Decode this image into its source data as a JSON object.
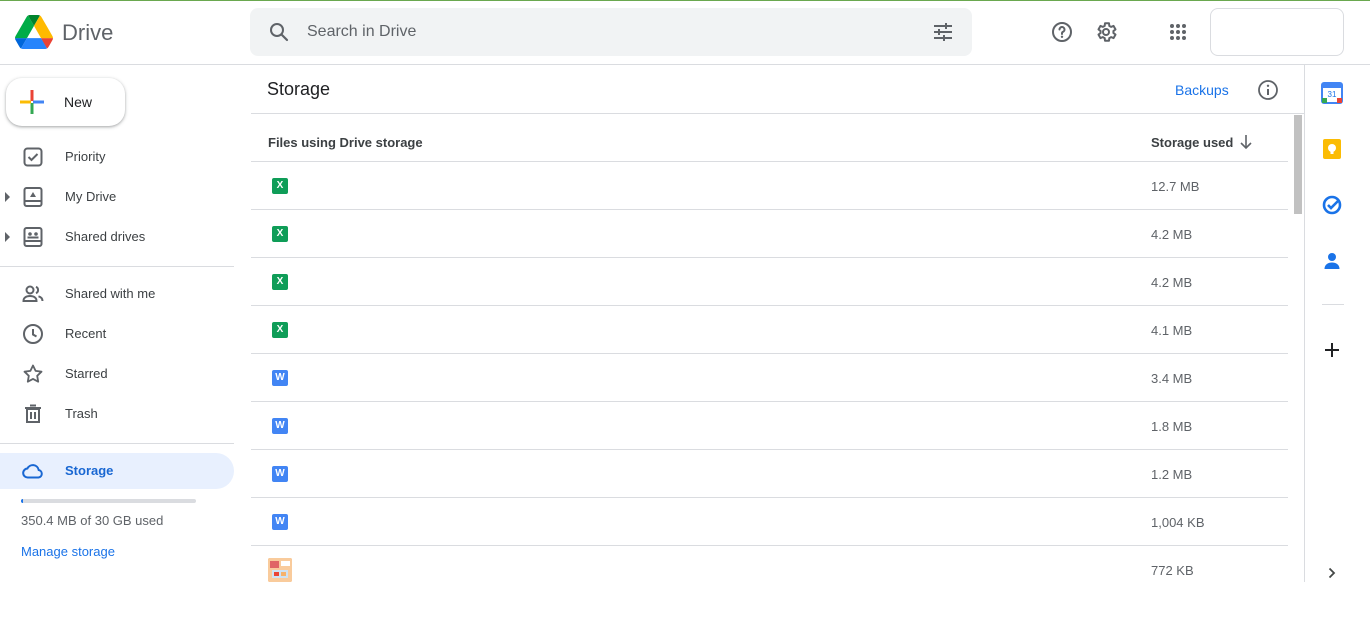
{
  "app": {
    "product_name": "Drive",
    "accent": "#1a73e8"
  },
  "search": {
    "placeholder": "Search in Drive",
    "value": ""
  },
  "header_icons": [
    "help-icon",
    "settings-icon",
    "apps-icon"
  ],
  "new_button": {
    "label": "New"
  },
  "sidebar": {
    "items": [
      {
        "id": "priority",
        "label": "Priority",
        "icon": "priority-icon",
        "expandable": false
      },
      {
        "id": "my-drive",
        "label": "My Drive",
        "icon": "my-drive-icon",
        "expandable": true
      },
      {
        "id": "shared-drives",
        "label": "Shared drives",
        "icon": "shared-drives-icon",
        "expandable": true
      },
      {
        "id": "shared-with-me",
        "label": "Shared with me",
        "icon": "people-icon",
        "expandable": false
      },
      {
        "id": "recent",
        "label": "Recent",
        "icon": "clock-icon",
        "expandable": false
      },
      {
        "id": "starred",
        "label": "Starred",
        "icon": "star-icon",
        "expandable": false
      },
      {
        "id": "trash",
        "label": "Trash",
        "icon": "trash-icon",
        "expandable": false
      },
      {
        "id": "storage",
        "label": "Storage",
        "icon": "cloud-icon",
        "expandable": false,
        "active": true
      }
    ],
    "quota": {
      "text": "350.4 MB of 30 GB used",
      "used_fraction": 0.0114
    },
    "manage_link": "Manage storage"
  },
  "main": {
    "title": "Storage",
    "backups_link": "Backups",
    "table": {
      "columns": {
        "name": "Files using Drive storage",
        "size": "Storage used"
      },
      "sort": "descending",
      "rows": [
        {
          "type": "xlsx",
          "icon_text": "X",
          "size": "12.7 MB"
        },
        {
          "type": "xlsx",
          "icon_text": "X",
          "size": "4.2 MB"
        },
        {
          "type": "xlsx",
          "icon_text": "X",
          "size": "4.2 MB"
        },
        {
          "type": "xlsx",
          "icon_text": "X",
          "size": "4.1 MB"
        },
        {
          "type": "docx",
          "icon_text": "W",
          "size": "3.4 MB"
        },
        {
          "type": "docx",
          "icon_text": "W",
          "size": "1.8 MB"
        },
        {
          "type": "docx",
          "icon_text": "W",
          "size": "1.2 MB"
        },
        {
          "type": "docx",
          "icon_text": "W",
          "size": "1,004 KB"
        },
        {
          "type": "image",
          "icon_text": "",
          "size": "772 KB"
        }
      ]
    }
  },
  "side_panel": {
    "apps": [
      "calendar-icon",
      "keep-icon",
      "tasks-icon",
      "contacts-icon"
    ],
    "calendar_day": "31"
  }
}
